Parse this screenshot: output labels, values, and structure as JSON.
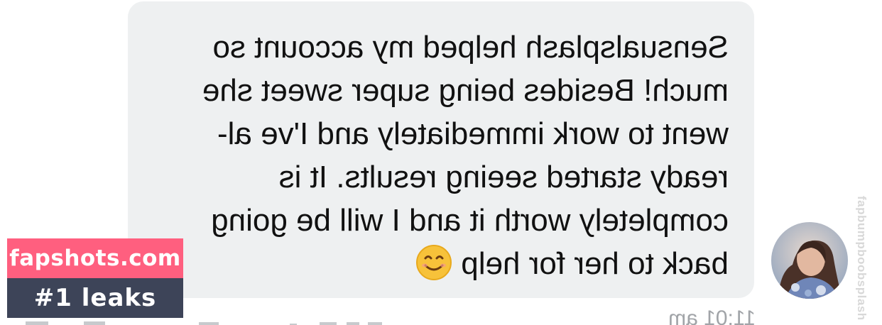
{
  "message": {
    "lines": [
      "Sensualsplash helped my account so",
      "much! Besides being super sweet she",
      "went to work immediately and I've al-",
      "ready started seeing results. It is",
      "completely worth it and I will be going",
      "back to her for help"
    ],
    "emoji": "smiling-face-emoji",
    "mirrored": true
  },
  "timestamp": "11:01 am",
  "avatar": {
    "icon": "profile-photo"
  },
  "watermarks": {
    "vertical": "fapbumpboobsplash",
    "brand_top": "fapshots.com",
    "brand_bottom": "#1 leaks"
  },
  "colors": {
    "bubble": "#eef0f1",
    "text": "#111111",
    "brand_pink": "#ff5f7f",
    "brand_navy": "#3d4458",
    "timestamp": "#a1a4a8"
  }
}
